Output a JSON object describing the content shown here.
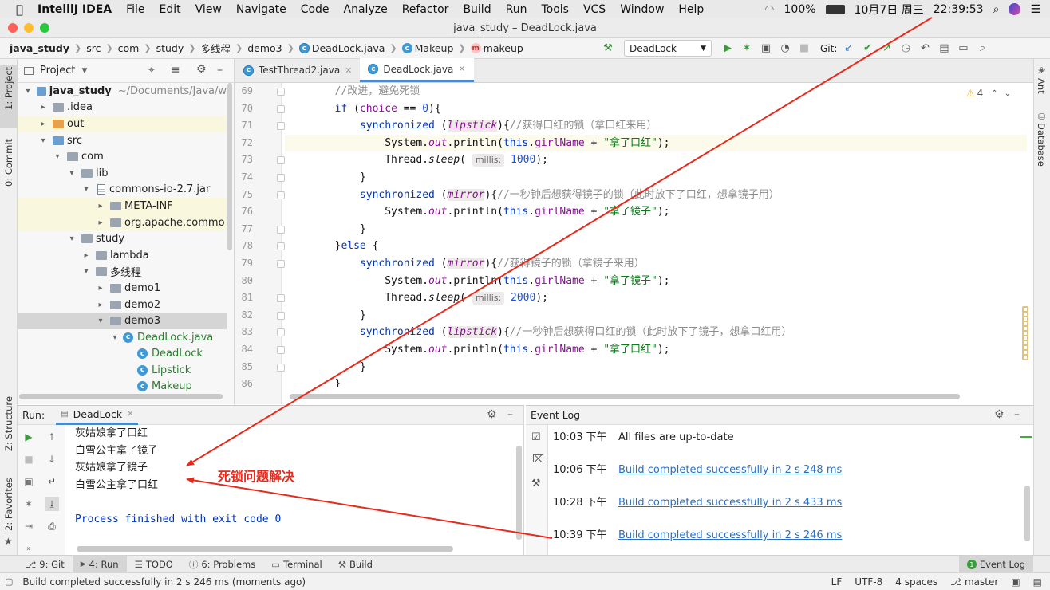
{
  "menubar": {
    "app": "IntelliJ IDEA",
    "items": [
      "File",
      "Edit",
      "View",
      "Navigate",
      "Code",
      "Analyze",
      "Refactor",
      "Build",
      "Run",
      "Tools",
      "VCS",
      "Window",
      "Help"
    ],
    "battery": "100%",
    "date": "10月7日 周三",
    "time": "22:39:53"
  },
  "window": {
    "title": "java_study – DeadLock.java"
  },
  "breadcrumb": [
    "java_study",
    "src",
    "com",
    "study",
    "多线程",
    "demo3",
    "DeadLock.java",
    "Makeup",
    "makeup"
  ],
  "toolbar": {
    "run_config": "DeadLock",
    "git_label": "Git:"
  },
  "project_panel": {
    "title": "Project",
    "tree": [
      {
        "label": "java_study",
        "extra": "~/Documents/Java/w",
        "depth": 0,
        "arrow": "▾",
        "icon": "folder-blue",
        "bold": true
      },
      {
        "label": ".idea",
        "depth": 1,
        "arrow": "▸",
        "icon": "folder"
      },
      {
        "label": "out",
        "depth": 1,
        "arrow": "▸",
        "icon": "folder-orange",
        "hl": true
      },
      {
        "label": "src",
        "depth": 1,
        "arrow": "▾",
        "icon": "folder-blue"
      },
      {
        "label": "com",
        "depth": 2,
        "arrow": "▾",
        "icon": "folder"
      },
      {
        "label": "lib",
        "depth": 3,
        "arrow": "▾",
        "icon": "folder"
      },
      {
        "label": "commons-io-2.7.jar",
        "depth": 4,
        "arrow": "▾",
        "icon": "jar"
      },
      {
        "label": "META-INF",
        "depth": 5,
        "arrow": "▸",
        "icon": "folder",
        "hl": true
      },
      {
        "label": "org.apache.commo",
        "depth": 5,
        "arrow": "▸",
        "icon": "folder",
        "hl": true
      },
      {
        "label": "study",
        "depth": 3,
        "arrow": "▾",
        "icon": "folder"
      },
      {
        "label": "lambda",
        "depth": 4,
        "arrow": "▸",
        "icon": "folder"
      },
      {
        "label": "多线程",
        "depth": 4,
        "arrow": "▾",
        "icon": "folder"
      },
      {
        "label": "demo1",
        "depth": 5,
        "arrow": "▸",
        "icon": "folder"
      },
      {
        "label": "demo2",
        "depth": 5,
        "arrow": "▸",
        "icon": "folder"
      },
      {
        "label": "demo3",
        "depth": 5,
        "arrow": "▾",
        "icon": "folder",
        "sel": true
      },
      {
        "label": "DeadLock.java",
        "depth": 6,
        "arrow": "▾",
        "icon": "class-file",
        "green": true
      },
      {
        "label": "DeadLock",
        "depth": 7,
        "arrow": "",
        "icon": "class",
        "green": true
      },
      {
        "label": "Lipstick",
        "depth": 7,
        "arrow": "",
        "icon": "class",
        "green": true
      },
      {
        "label": "Makeup",
        "depth": 7,
        "arrow": "",
        "icon": "class",
        "green": true
      }
    ]
  },
  "editor": {
    "tabs": [
      {
        "label": "TestThread2.java"
      },
      {
        "label": "DeadLock.java",
        "active": true
      }
    ],
    "warnings": "4",
    "line_numbers": [
      "69",
      "70",
      "71",
      "72",
      "73",
      "74",
      "75",
      "76",
      "77",
      "78",
      "79",
      "80",
      "81",
      "82",
      "83",
      "84",
      "85",
      "86"
    ],
    "hint_label": "millis:",
    "strings": {
      "comment_69": "//改进，避免死锁",
      "comment_71": "//获得口红的锁（拿口红来用）",
      "comment_75": "//一秒钟后想获得镜子的锁（此时放下了口红，想拿镜子用）",
      "comment_79": "//获得镜子的锁（拿镜子来用）",
      "comment_83": "//一秒钟后想获得口红的锁（此时放下了镜子，想拿口红用）",
      "lipstick_str": "\"拿了口红\"",
      "mirror_str": "\"拿了镜子\"",
      "n1000": "1000",
      "n2000": "2000",
      "n0": "0"
    }
  },
  "run_panel": {
    "label": "Run:",
    "tab": "DeadLock",
    "output": [
      "灰姑娘拿了口红",
      "白雪公主拿了镜子",
      "灰姑娘拿了镜子",
      "白雪公主拿了口红",
      "",
      "Process finished with exit code 0"
    ]
  },
  "annotation": {
    "text": "死锁问题解决",
    "color": "#e8291c"
  },
  "event_log": {
    "title": "Event Log",
    "entries": [
      {
        "time": "10:03 下午",
        "text": "All files are up-to-date",
        "link": false
      },
      {
        "time": "10:06 下午",
        "text": "Build completed successfully in 2 s 248 ms",
        "link": true
      },
      {
        "time": "10:28 下午",
        "text": "Build completed successfully in 2 s 433 ms",
        "link": true
      },
      {
        "time": "10:39 下午",
        "text": "Build completed successfully in 2 s 246 ms",
        "link": true
      }
    ]
  },
  "tool_tabs": [
    {
      "label": "9: Git",
      "icon": "git-icon"
    },
    {
      "label": "4: Run",
      "icon": "run-icon",
      "active": true
    },
    {
      "label": "TODO",
      "icon": "todo-icon"
    },
    {
      "label": "6: Problems",
      "icon": "problems-icon"
    },
    {
      "label": "Terminal",
      "icon": "terminal-icon"
    },
    {
      "label": "Build",
      "icon": "build-icon"
    }
  ],
  "event_log_tab": "Event Log",
  "side_tabs": {
    "project": "1: Project",
    "commit": "0: Commit",
    "structure": "Z: Structure",
    "favorites": "2: Favorites",
    "ant": "Ant",
    "database": "Database"
  },
  "status_bar": {
    "message": "Build completed successfully in 2 s 246 ms (moments ago)",
    "line_sep": "LF",
    "encoding": "UTF-8",
    "indent": "4 spaces",
    "branch": "master"
  }
}
